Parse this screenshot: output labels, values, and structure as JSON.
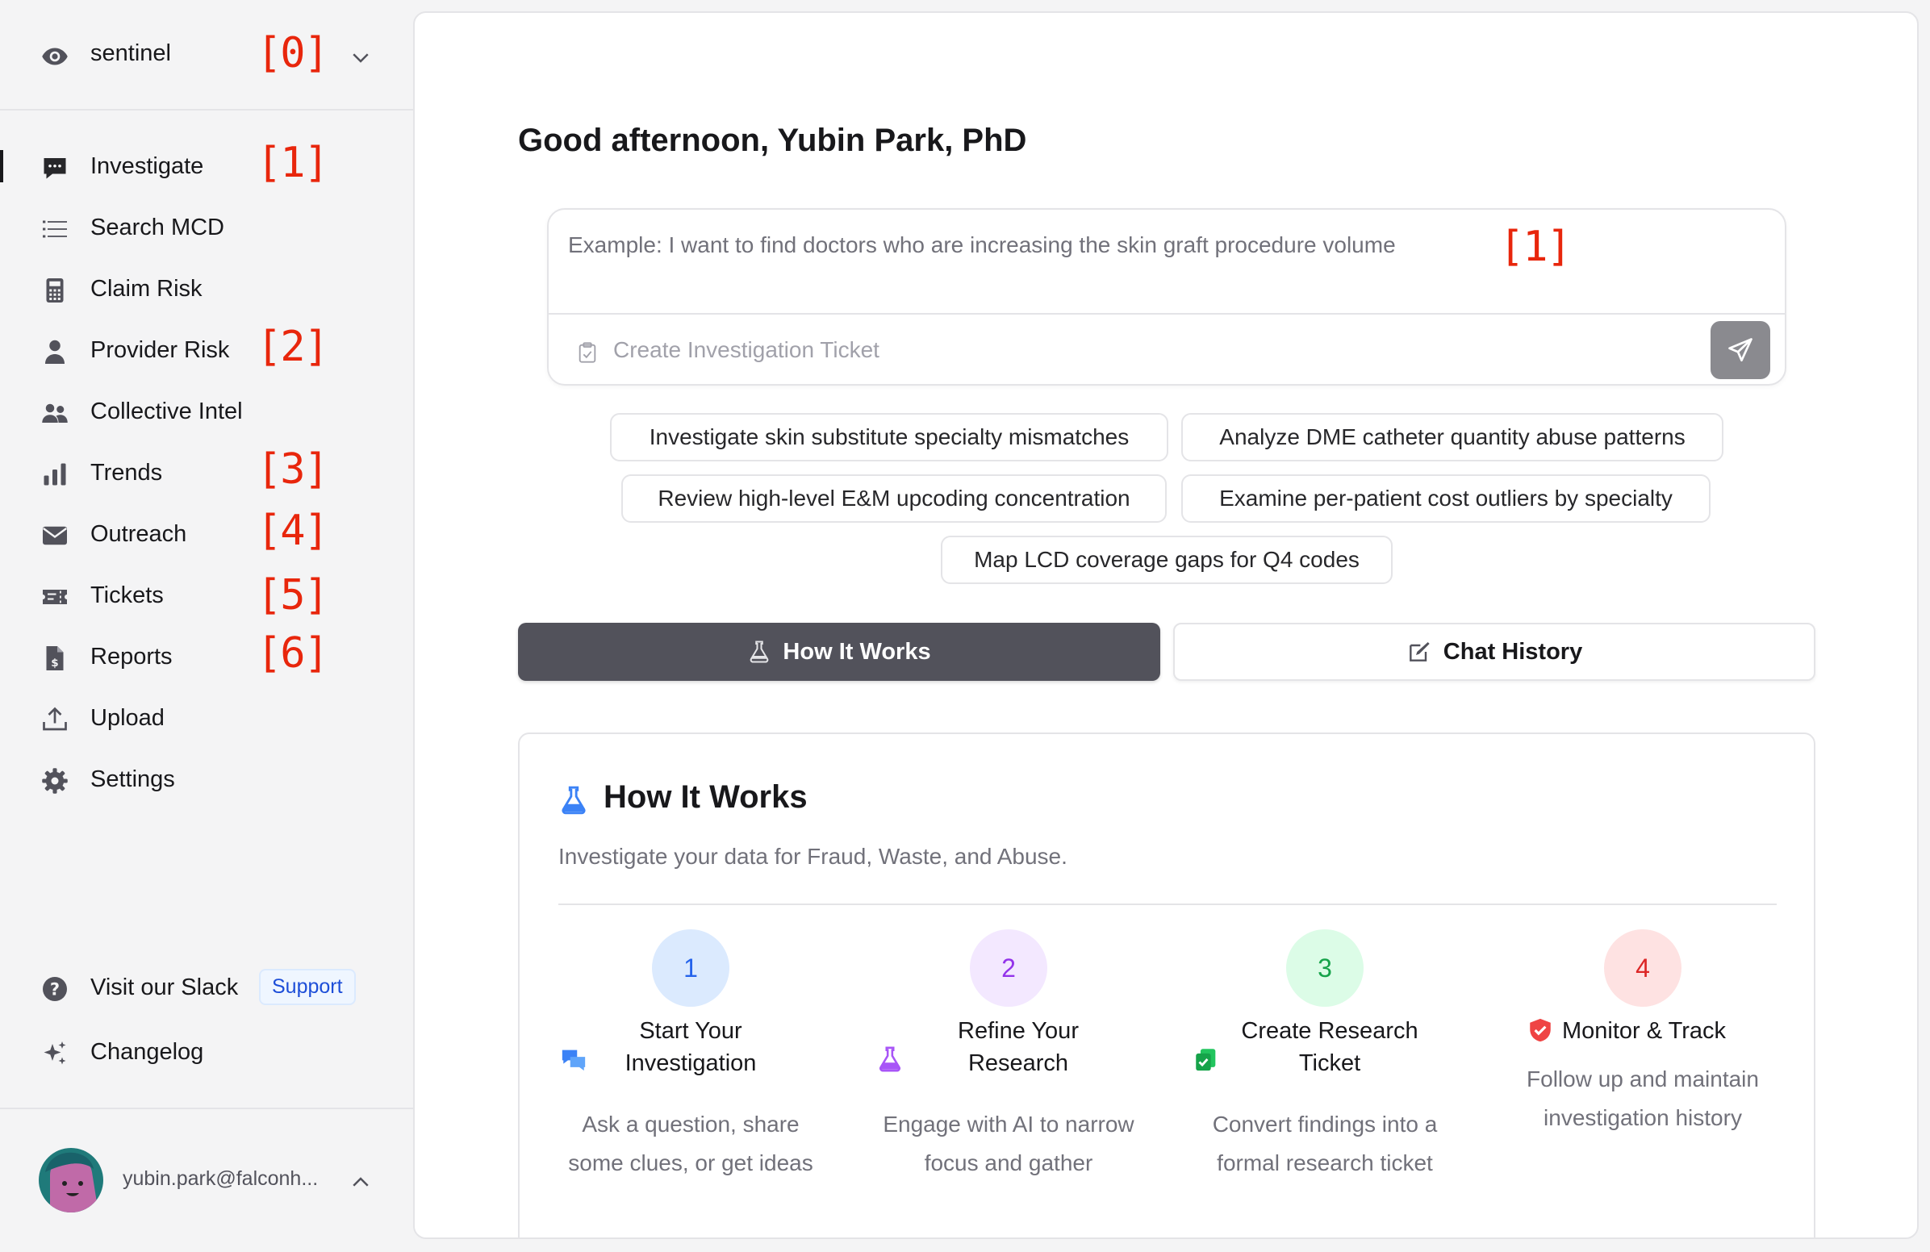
{
  "workspace": {
    "name": "sentinel",
    "marker": "[0]"
  },
  "nav": {
    "items": [
      {
        "label": "Investigate",
        "icon": "chat-bubble-icon",
        "marker": "[1]"
      },
      {
        "label": "Search MCD",
        "icon": "list-icon",
        "marker": ""
      },
      {
        "label": "Claim Risk",
        "icon": "calculator-icon",
        "marker": ""
      },
      {
        "label": "Provider Risk",
        "icon": "user-icon",
        "marker": "[2]"
      },
      {
        "label": "Collective Intel",
        "icon": "users-icon",
        "marker": ""
      },
      {
        "label": "Trends",
        "icon": "bar-chart-icon",
        "marker": "[3]"
      },
      {
        "label": "Outreach",
        "icon": "envelope-icon",
        "marker": "[4]"
      },
      {
        "label": "Tickets",
        "icon": "ticket-icon",
        "marker": "[5]"
      },
      {
        "label": "Reports",
        "icon": "file-invoice-icon",
        "marker": "[6]"
      },
      {
        "label": "Upload",
        "icon": "upload-icon",
        "marker": ""
      },
      {
        "label": "Settings",
        "icon": "gear-icon",
        "marker": ""
      }
    ]
  },
  "footer": {
    "slack_label": "Visit our Slack",
    "slack_badge": "Support",
    "changelog_label": "Changelog",
    "user_email": "yubin.park@falconh..."
  },
  "main": {
    "greeting": "Good afternoon, Yubin Park, PhD",
    "query_placeholder": "Example: I want to find doctors who are increasing the skin graft procedure volume",
    "query_marker": "[1]",
    "ticket_label": "Create Investigation Ticket",
    "suggestions": [
      "Investigate skin substitute specialty mismatches",
      "Analyze DME catheter quantity abuse patterns",
      "Review high-level E&M upcoding concentration",
      "Examine per-patient cost outliers by specialty",
      "Map LCD coverage gaps for Q4 codes"
    ],
    "tabs": {
      "how_it_works": "How It Works",
      "chat_history": "Chat History"
    }
  },
  "how_it_works": {
    "title": "How It Works",
    "subtitle": "Investigate your data for Fraud, Waste, and Abuse.",
    "steps": [
      {
        "number": "1",
        "title": "Start Your Investigation",
        "description": "Ask a question, share some clues, or get ideas",
        "icon": "chat-bubbles-icon",
        "color": "#3b82f6"
      },
      {
        "number": "2",
        "title": "Refine Your Research",
        "description": "Engage with AI to narrow focus and gather",
        "icon": "flask-icon",
        "color": "#a855f7"
      },
      {
        "number": "3",
        "title": "Create Research Ticket",
        "description": "Convert findings into a formal research ticket",
        "icon": "clipboard-check-icon",
        "color": "#22c55e"
      },
      {
        "number": "4",
        "title": "Monitor & Track",
        "description": "Follow up and maintain investigation history",
        "icon": "shield-check-icon",
        "color": "#ef4444"
      }
    ]
  }
}
